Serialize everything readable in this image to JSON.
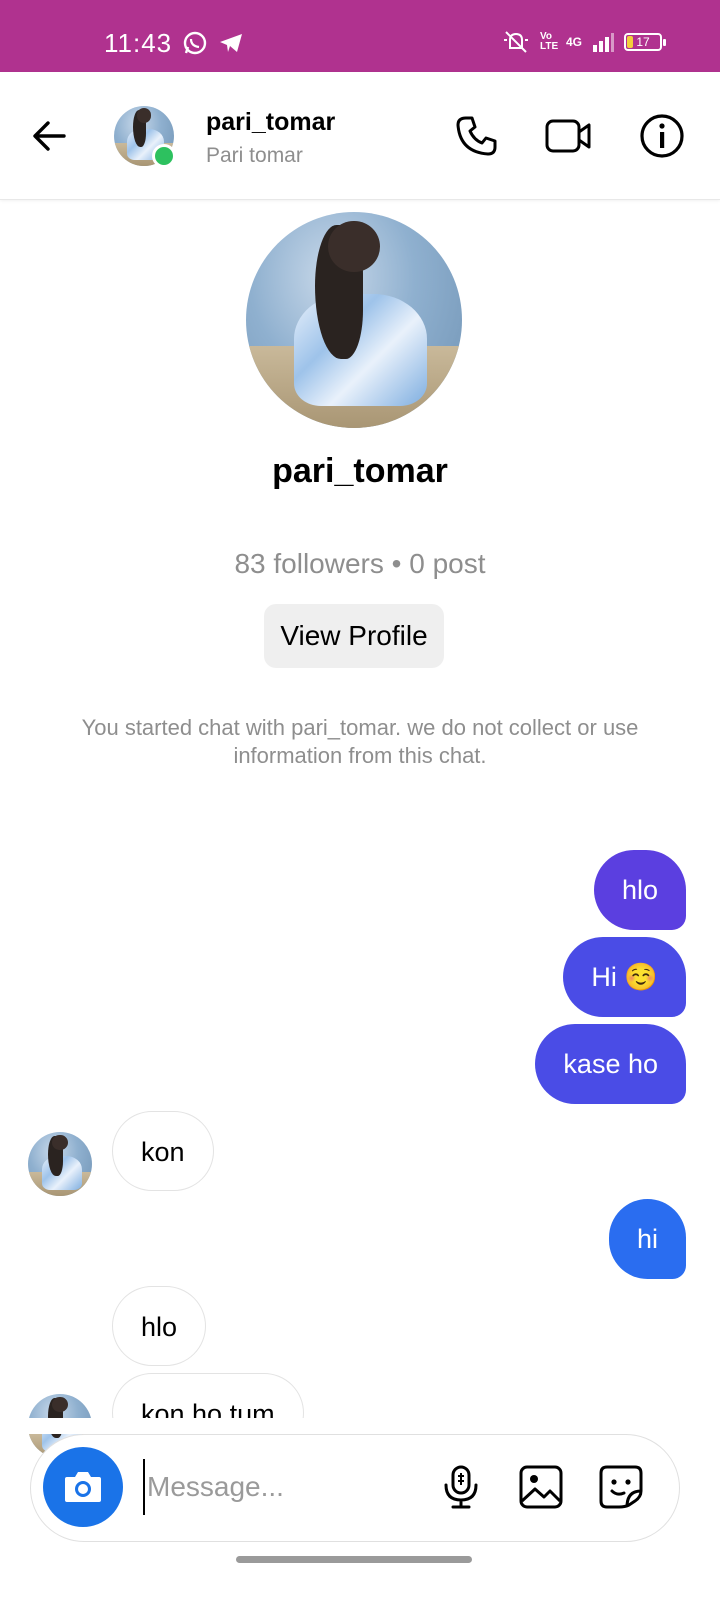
{
  "colors": {
    "statusbar": "#b0328f",
    "outgoing_top": "#5b3fe0",
    "outgoing_mid": "#4a4ce6",
    "outgoing_bottom": "#2a6df0",
    "online": "#2dc15f",
    "camera": "#1a73e8"
  },
  "status_bar": {
    "time": "11:43",
    "battery": "17",
    "network": "4G",
    "volte": "Vo LTE",
    "left_icons": [
      "whatsapp-icon",
      "telegram-icon"
    ],
    "right_icons": [
      "mute-icon",
      "volte-icon",
      "signal-icon",
      "battery-icon"
    ]
  },
  "header": {
    "username": "pari_tomar",
    "display_name": "Pari tomar",
    "icons": [
      "back-arrow-icon",
      "phone-icon",
      "video-call-icon",
      "info-icon"
    ]
  },
  "profile": {
    "username": "pari_tomar",
    "stats": "83 followers • 0 post",
    "view_profile_label": "View Profile",
    "notice": "You started chat with pari_tomar. we do not collect or use information from this chat."
  },
  "messages": [
    {
      "direction": "out",
      "text": "hlo"
    },
    {
      "direction": "out",
      "text": "Hi ☺️"
    },
    {
      "direction": "out",
      "text": "kase ho"
    },
    {
      "direction": "in",
      "text": "kon"
    },
    {
      "direction": "out",
      "text": "hi"
    },
    {
      "direction": "in",
      "text": "hlo"
    },
    {
      "direction": "in",
      "text": "kon ho tum"
    }
  ],
  "composer": {
    "placeholder": "Message...",
    "icons": [
      "camera-icon",
      "microphone-icon",
      "gallery-icon",
      "sticker-icon"
    ]
  }
}
